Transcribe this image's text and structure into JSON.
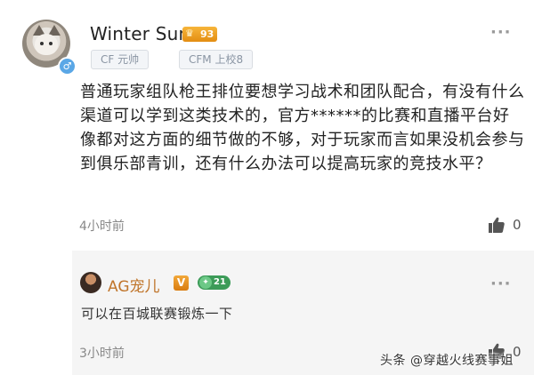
{
  "post": {
    "username": "Winter Sun",
    "level": "93",
    "tags": [
      "CF 元帅",
      "CFM 上校8"
    ],
    "body": "普通玩家组队枪王排位要想学习战术和团队配合，有没有什么渠道可以学到这类技术的，官方******的比赛和直播平台好像都对这方面的细节做的不够，对于玩家而言如果没机会参与到俱乐部青训，还有什么办法可以提高玩家的竞技水平？",
    "time": "4小时前",
    "like_count": "0",
    "gender_icon": "male-icon",
    "more_label": "···"
  },
  "reply": {
    "username": "AG宠儿",
    "verified": "V",
    "level": "21",
    "body": "可以在百城联赛锻炼一下",
    "time": "3小时前",
    "like_count": "0",
    "more_label": "···"
  },
  "watermark": "头条 @穿越火线赛事姐",
  "colors": {
    "reply_name": "#c0752b",
    "reply_bg": "#f5f5f5",
    "tag_text": "#8a95a3",
    "gender_badge": "#5aa7e6"
  }
}
